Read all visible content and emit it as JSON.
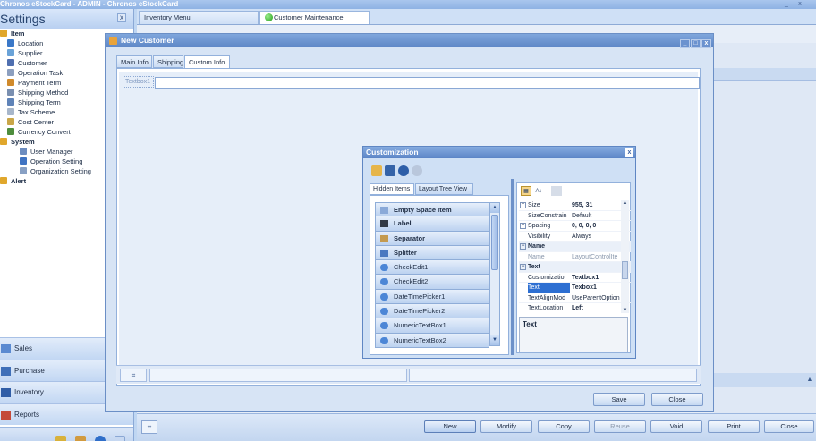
{
  "app": {
    "title": "Chronos eStockCard - ADMIN - Chronos eStockCard",
    "min": "_",
    "close": "x"
  },
  "left": {
    "header": "Settings",
    "close_glyph": "x",
    "tree": [
      {
        "label": "Item",
        "level": 0,
        "color": "#e0a72c"
      },
      {
        "label": "Location",
        "level": 1,
        "color": "#3a78c8"
      },
      {
        "label": "Supplier",
        "level": 1,
        "color": "#6aa3d8"
      },
      {
        "label": "Customer",
        "level": 1,
        "color": "#4f6fb0"
      },
      {
        "label": "Operation Task",
        "level": 1,
        "color": "#8c9fbf"
      },
      {
        "label": "Payment Term",
        "level": 1,
        "color": "#d08a2c"
      },
      {
        "label": "Shipping Method",
        "level": 1,
        "color": "#7a8fb0"
      },
      {
        "label": "Shipping Term",
        "level": 1,
        "color": "#5f83b8"
      },
      {
        "label": "Tax Scheme",
        "level": 1,
        "color": "#a7b6ca"
      },
      {
        "label": "Cost Center",
        "level": 1,
        "color": "#c9a648"
      },
      {
        "label": "Currency Convert",
        "level": 1,
        "color": "#4e8d3d"
      },
      {
        "label": "System",
        "level": 0,
        "color": "#e0a72c"
      },
      {
        "label": "User Manager",
        "level": 2,
        "color": "#6d8dc0"
      },
      {
        "label": "Operation Setting",
        "level": 2,
        "color": "#3f73c2"
      },
      {
        "label": "Organization Setting",
        "level": 2,
        "color": "#88a0c4"
      },
      {
        "label": "Alert",
        "level": 0,
        "color": "#e0a72c"
      }
    ],
    "nav": [
      {
        "label": "Sales",
        "color": "#5a8ad1"
      },
      {
        "label": "Purchase",
        "color": "#3f6fb8"
      },
      {
        "label": "Inventory",
        "color": "#2f5da6"
      },
      {
        "label": "Reports",
        "color": "#c44a3a"
      }
    ]
  },
  "tabs": {
    "inventory_menu": "Inventory Menu",
    "customer_maintenance": "Customer Maintenance"
  },
  "dialog": {
    "title": "New Customer",
    "tabs": [
      "Main Info",
      "Shipping",
      "Custom Info"
    ],
    "textbox_label": "Textbox1",
    "textbox_value": "",
    "save": "Save",
    "close": "Close"
  },
  "customization": {
    "title": "Customization",
    "close_glyph": "x",
    "tabs": [
      "Hidden Items",
      "Layout Tree View"
    ],
    "hidden_items": [
      {
        "label": "Empty Space Item",
        "bold": true
      },
      {
        "label": "Label",
        "bold": true
      },
      {
        "label": "Separator",
        "bold": true
      },
      {
        "label": "Splitter",
        "bold": true
      },
      {
        "label": "CheckEdit1",
        "bold": false
      },
      {
        "label": "CheckEdit2",
        "bold": false
      },
      {
        "label": "DateTimePicker1",
        "bold": false
      },
      {
        "label": "DateTimePicker2",
        "bold": false
      },
      {
        "label": "NumericTextBox1",
        "bold": false
      },
      {
        "label": "NumericTextBox2",
        "bold": false
      }
    ],
    "properties": [
      {
        "key": "Size",
        "value": "955, 31",
        "bold": true,
        "expander": "+"
      },
      {
        "key": "SizeConstrain",
        "value": "Default",
        "bold": false
      },
      {
        "key": "Spacing",
        "value": "0, 0, 0, 0",
        "bold": true,
        "expander": "+"
      },
      {
        "key": "Visibility",
        "value": "Always",
        "bold": false
      },
      {
        "key": "Name",
        "category": true,
        "expander": "−"
      },
      {
        "key": "Name",
        "value": "LayoutControlIte",
        "dim": true
      },
      {
        "key": "Text",
        "category": true,
        "expander": "−"
      },
      {
        "key": "Customizatior",
        "value": "Textbox1",
        "bold": true
      },
      {
        "key": "Text",
        "value": "Texbox1",
        "bold": true,
        "selected": true
      },
      {
        "key": "TextAlignMod",
        "value": "UseParentOption",
        "bold": false
      },
      {
        "key": "TextLocation",
        "value": "Left",
        "bold": true
      }
    ],
    "description": "Text"
  },
  "toolbar": {
    "buttons": [
      {
        "label": "New",
        "primary": true,
        "disabled": false
      },
      {
        "label": "Modify",
        "primary": false,
        "disabled": false
      },
      {
        "label": "Copy",
        "primary": false,
        "disabled": false
      },
      {
        "label": "Reuse",
        "primary": false,
        "disabled": true
      },
      {
        "label": "Void",
        "primary": false,
        "disabled": false
      },
      {
        "label": "Print",
        "primary": false,
        "disabled": false
      },
      {
        "label": "Close",
        "primary": false,
        "disabled": false
      }
    ]
  }
}
